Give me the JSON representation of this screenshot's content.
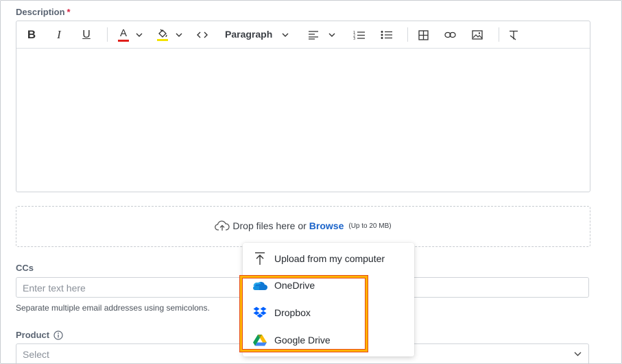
{
  "description": {
    "label": "Description",
    "required_mark": "*"
  },
  "toolbar": {
    "bold": "B",
    "italic": "I",
    "underline": "U",
    "text_color_letter": "A",
    "text_color": "#e0201b",
    "highlight_color": "#f4e300",
    "block_format": "Paragraph"
  },
  "dropzone": {
    "text": "Drop files here or",
    "browse_label": "Browse",
    "limit": "(Up to 20 MB)"
  },
  "ccs": {
    "label": "CCs",
    "placeholder": "Enter text here",
    "help": "Separate multiple email addresses using semicolons."
  },
  "product": {
    "label": "Product",
    "placeholder": "Select"
  },
  "upload_menu": {
    "items": [
      {
        "label": "Upload from my computer",
        "icon": "upload-icon"
      },
      {
        "label": "OneDrive",
        "icon": "onedrive-icon"
      },
      {
        "label": "Dropbox",
        "icon": "dropbox-icon"
      },
      {
        "label": "Google Drive",
        "icon": "google-drive-icon"
      }
    ],
    "highlight_color": "#ffb300"
  }
}
